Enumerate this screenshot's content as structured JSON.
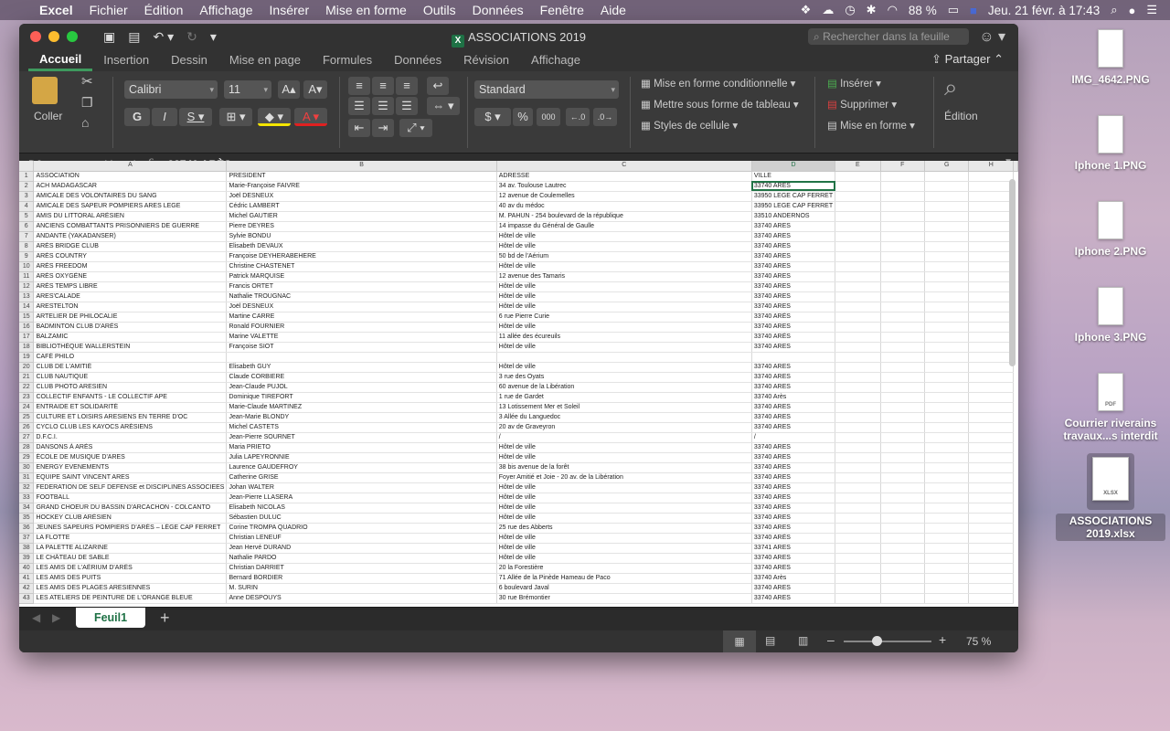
{
  "menubar": {
    "app": "Excel",
    "items": [
      "Fichier",
      "Édition",
      "Affichage",
      "Insérer",
      "Mise en forme",
      "Outils",
      "Données",
      "Fenêtre",
      "Aide"
    ],
    "battery": "88 %",
    "clock": "Jeu. 21 févr. à 17:43"
  },
  "desktop": [
    {
      "label": "IMG_4642.PNG"
    },
    {
      "label": "Iphone 1.PNG"
    },
    {
      "label": "Iphone 2.PNG"
    },
    {
      "label": "Iphone 3.PNG"
    },
    {
      "label": "Courrier riverains travaux...s interdit"
    },
    {
      "label": "ASSOCIATIONS 2019.xlsx"
    }
  ],
  "window": {
    "title": "ASSOCIATIONS 2019",
    "search_placeholder": "Rechercher dans la feuille",
    "tabs": [
      "Accueil",
      "Insertion",
      "Dessin",
      "Mise en page",
      "Formules",
      "Données",
      "Révision",
      "Affichage"
    ],
    "share": "Partager"
  },
  "ribbon": {
    "paste": "Coller",
    "font": "Calibri",
    "size": "11",
    "number_format": "Standard",
    "cond_format": "Mise en forme conditionnelle",
    "table_format": "Mettre sous forme de tableau",
    "cell_styles": "Styles de cellule",
    "insert": "Insérer",
    "delete": "Supprimer",
    "format": "Mise en forme",
    "edition": "Édition",
    "percent": "%",
    "thousands": "000"
  },
  "formula": {
    "cell": "D2",
    "content": "33740 ARÈS"
  },
  "grid": {
    "columns": [
      "A",
      "B",
      "C",
      "D",
      "E",
      "F",
      "G",
      "H"
    ],
    "rows": [
      [
        "ASSOCIATION",
        "PRESIDENT",
        "ADRESSE",
        "VILLE"
      ],
      [
        "ACH MADAGASCAR",
        "Marie-Françoise FAIVRE",
        "34 av. Toulouse Lautrec",
        "33740 ARÈS"
      ],
      [
        "AMICALE DES VOLONTAIRES DU SANG",
        "Joël DESNEUX",
        "12 avenue de Coulemelles",
        "33950 LEGE CAP FERRET"
      ],
      [
        "AMICALE DES SAPEUR POMPIERS ARES LEGE",
        "Cédric LAMBERT",
        "40 av du médoc",
        "33950 LEGE CAP FERRET"
      ],
      [
        "AMIS DU LITTORAL ARÉSIEN",
        "Michel GAUTIER",
        "M. PAHUN - 254 boulevard de la république",
        "33510 ANDERNOS"
      ],
      [
        "ANCIENS COMBATTANTS PRISONNIERS DE GUERRE",
        "Pierre DEYRES",
        "14 impasse du Général de Gaulle",
        "33740 ARES"
      ],
      [
        "ANDANTE (YAKADANSER)",
        "Sylvie BONDU",
        "Hôtel de ville",
        "33740 ARES"
      ],
      [
        "ARÈS BRIDGE CLUB",
        "Elisabeth DEVAUX",
        "Hôtel de ville",
        "33740 ARES"
      ],
      [
        "ARÈS COUNTRY",
        " Françoise DEYHERABEHERE",
        "50 bd de l'Aérium",
        "33740 ARES"
      ],
      [
        "ARÈS FREEDOM",
        "Christine CHASTENET",
        "Hôtel de ville",
        "33740 ARES"
      ],
      [
        "ARÈS OXYGÈNE",
        "Patrick MARQUISE",
        "12 avenue des Tamaris",
        "33740 ARES"
      ],
      [
        "ARÈS TEMPS LIBRE",
        "Francis ORTET",
        "Hôtel de ville",
        "33740 ARES"
      ],
      [
        "ARES'CALADE",
        "Nathalie TROUGNAC",
        "Hôtel de ville",
        "33740 ARES"
      ],
      [
        "ARESTELTON",
        "Joël DESNEUX",
        "Hôtel de ville",
        "33740 ARES"
      ],
      [
        "ARTELIER DE PHILOCALIE",
        "Martine CARRE",
        "6 rue Pierre Curie",
        "33740 ARÈS"
      ],
      [
        "BADMINTON CLUB D'ARÈS",
        "Ronald FOURNIER",
        "Hôtel de ville",
        "33740 ARES"
      ],
      [
        "BALZAMIC",
        "Marine VALETTE",
        "11 allée des écureuils",
        "33740 ARÈS"
      ],
      [
        "BIBLIOTHÈQUE WALLERSTEIN",
        "Françoise SIOT",
        "Hôtel de ville",
        "33740 ARES"
      ],
      [
        "CAFÉ PHILO",
        "",
        "",
        ""
      ],
      [
        "CLUB DE L'AMITIÉ",
        "Elisabeth GUY",
        "Hôtel de ville",
        "33740 ARES"
      ],
      [
        "CLUB NAUTIQUE",
        "Claude CORBIERE",
        "3 rue des Oyats",
        "33740 ARES"
      ],
      [
        "CLUB PHOTO ARESIEN",
        "Jean-Claude PUJOL",
        "60 avenue de la Libération",
        "33740 ARES"
      ],
      [
        "COLLECTIF ENFANTS - LE COLLECTIF APE",
        "Dominique TIREFORT",
        "1 rue de Gardet",
        "33740 Arès"
      ],
      [
        "ENTRAIDE ET SOLIDARITÉ",
        "Marie-Claude MARTINEZ",
        "13 Lotissement Mer et Soleil",
        "33740 ARES"
      ],
      [
        "CULTURE ET LOISIRS ARESIENS EN TERRE D'OC",
        "Jean-Marie BLONDY",
        "3 Allée du Languedoc",
        "33740 ARES"
      ],
      [
        "CYCLO CLUB LES KAYOCS ARÉSIENS",
        "Michel CASTETS",
        "20 av de Graveyron",
        "33740 ARES"
      ],
      [
        "D.F.C.I.",
        "Jean-Pierre SOURNET",
        "/",
        "/"
      ],
      [
        "DANSONS À ARÈS",
        "Maria PRIETO",
        "Hôtel de ville",
        "33740 ARES"
      ],
      [
        "ÉCOLE DE MUSIQUE D'ARES",
        "Julia LAPEYRONNIE",
        "Hôtel de ville",
        "33740 ARES"
      ],
      [
        "ENERGY  EVENEMENTS",
        "Laurence GAUDEFROY",
        "38 bis avenue de la forêt",
        "33740 ARES"
      ],
      [
        "EQUIPE SAINT VINCENT ARES",
        "Catherine GRISE",
        "Foyer Amitié et Joie - 20 av. de la Libération",
        "33740 ARES"
      ],
      [
        "FEDERATION DE SELF DEFENSE et DISCIPLINES ASSOCIEES",
        "Johan WALTER",
        "Hôtel de ville",
        "33740 ARES"
      ],
      [
        "FOOTBALL",
        "Jean-Pierre LLASERA",
        "Hôtel de ville",
        "33740 ARES"
      ],
      [
        "GRAND CHOEUR DU BASSIN D'ARCACHON - COLCANTO",
        "Elisabeth NICOLAS",
        "Hôtel de ville",
        "33740 ARES"
      ],
      [
        "HOCKEY CLUB ARÉSIEN",
        "Sébastien DULUC",
        "Hôtel de ville",
        "33740 ARES"
      ],
      [
        "JEUNES SAPEURS POMPIERS D'ARÈS – LÈGE CAP FERRET",
        "Corine TROMPA QUADRIO",
        "25 rue des Abberts",
        "33740 ARES"
      ],
      [
        "LA FLOTTE",
        "Christian LENEUF",
        "Hôtel de ville",
        "33740 ARÈS"
      ],
      [
        "LA PALETTE ALIZARINE",
        "Jean Hervé DURAND",
        "Hôtel de ville",
        "33741 ARES"
      ],
      [
        "LE CHÂTEAU DE SABLE",
        "Nathalie PARDO",
        "Hôtel de ville",
        "33740 ARES"
      ],
      [
        "LES AMIS DE L'AÉRIUM D'ARÈS",
        "Christian DARRIET",
        "20 la Forestière",
        "33740 ARES"
      ],
      [
        "LES AMIS DES PUITS",
        "Bernard BORDIER",
        "71 Allée de la Pinède Hameau de Paco",
        "33740 Arès"
      ],
      [
        "LES AMIS DES PLAGES ARESIENNES",
        "M. SURIN",
        "6 boulevard Javal",
        "33740 ARES"
      ],
      [
        "LES ATELIERS DE PEINTURE DE L'ORANGE BLEUE",
        "Anne DESPOUYS",
        "30 rue Brémontier",
        "33740 ARES"
      ]
    ]
  },
  "sheet": {
    "tab": "Feuil1",
    "zoom": "75 %",
    "zoom_fraction": 0.38
  }
}
